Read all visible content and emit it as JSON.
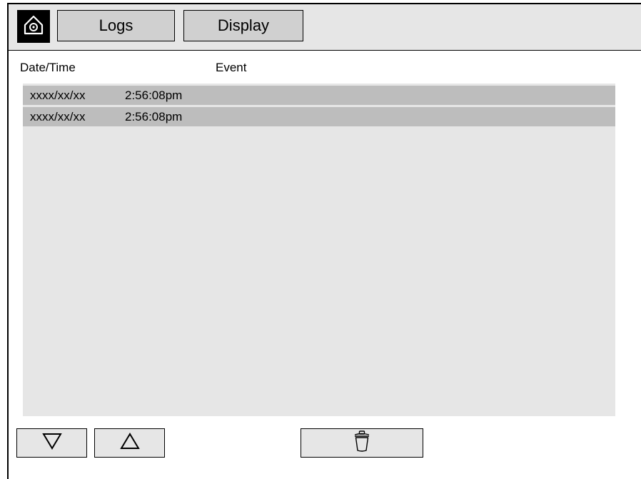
{
  "header": {
    "home_icon": "home-icon",
    "tabs": [
      {
        "label": "Logs"
      },
      {
        "label": "Display"
      }
    ]
  },
  "columns": {
    "date_time": "Date/Time",
    "event": "Event"
  },
  "log_rows": [
    {
      "date": "xxxx/xx/xx",
      "time": "2:56:08pm",
      "event": ""
    },
    {
      "date": "xxxx/xx/xx",
      "time": "2:56:08pm",
      "event": ""
    }
  ],
  "controls": {
    "scroll_down_icon": "triangle-down-icon",
    "scroll_up_icon": "triangle-up-icon",
    "delete_icon": "trash-icon"
  },
  "colors": {
    "panel": "#e6e6e6",
    "row": "#bdbdbd",
    "tab": "#d0d0d0"
  }
}
